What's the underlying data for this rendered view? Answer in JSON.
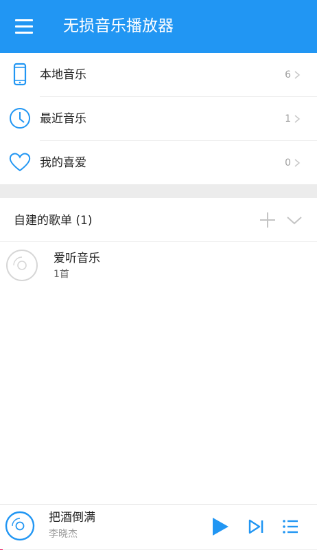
{
  "appbar": {
    "title": "无损音乐播放器",
    "menu_icon": "hamburger-menu-icon",
    "color": "#2196f3"
  },
  "nav": [
    {
      "label": "本地音乐",
      "count": "6",
      "icon": "phone-icon"
    },
    {
      "label": "最近音乐",
      "count": "1",
      "icon": "clock-icon"
    },
    {
      "label": "我的喜爱",
      "count": "0",
      "icon": "heart-icon"
    }
  ],
  "playlists": {
    "title": "自建的歌单 (1)",
    "add_icon": "plus-icon",
    "collapse_icon": "chevron-down-icon",
    "items": [
      {
        "name": "爱听音乐",
        "count": "1首",
        "icon": "disc-icon"
      }
    ]
  },
  "player": {
    "song": "把酒倒满",
    "artist": "李晓杰",
    "progress": 0.0,
    "progress_color": "#e91e63",
    "icons": [
      "disc-icon",
      "play-icon",
      "skip-next-icon",
      "playlist-icon"
    ]
  }
}
